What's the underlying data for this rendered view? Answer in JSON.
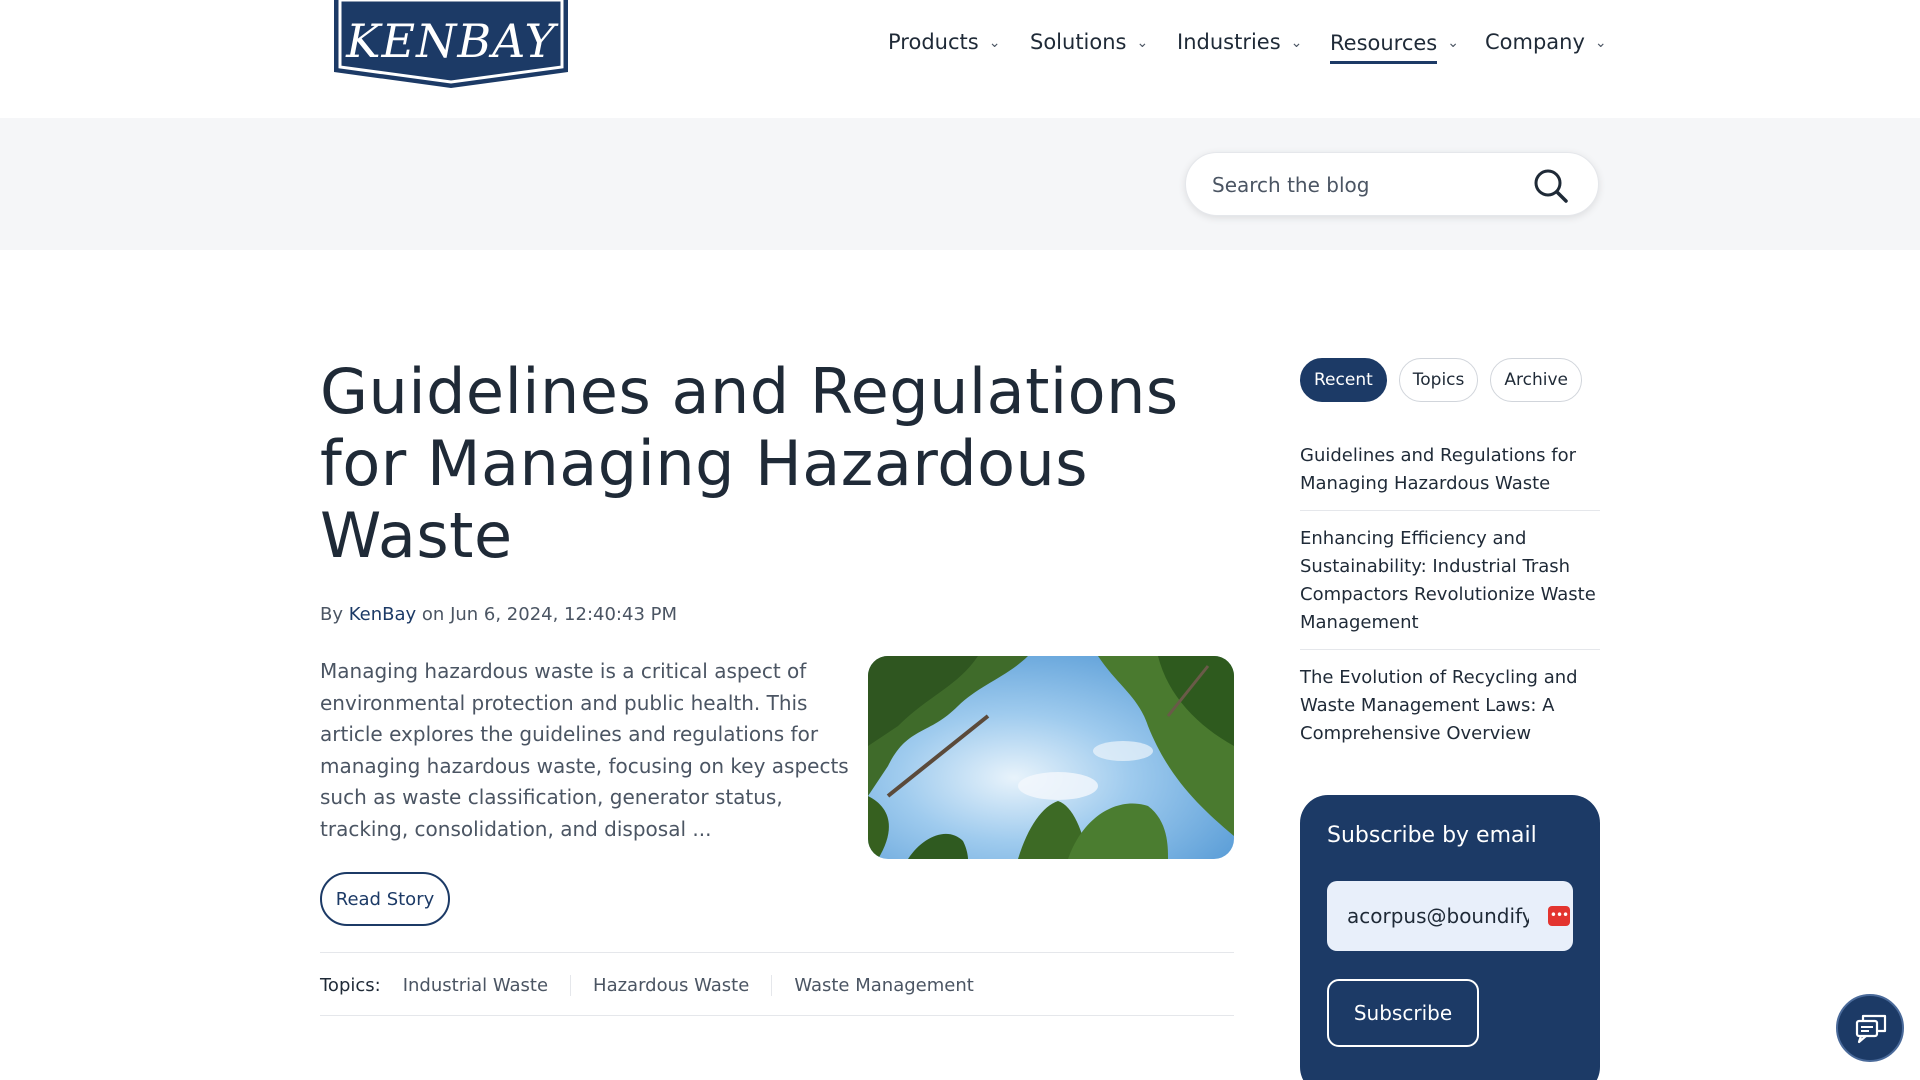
{
  "brand": {
    "logo_text": "KENBAY",
    "primary_color": "#1c3a66"
  },
  "nav": {
    "items": [
      {
        "label": "Products"
      },
      {
        "label": "Solutions"
      },
      {
        "label": "Industries"
      },
      {
        "label": "Resources",
        "active": true
      },
      {
        "label": "Company"
      }
    ],
    "chevron_icon": "chevron-down-icon"
  },
  "search": {
    "placeholder": "Search the blog",
    "icon": "search-icon"
  },
  "article": {
    "title": "Guidelines and Regulations for Managing Hazardous Waste",
    "by_label": "By",
    "author": "KenBay",
    "on_label": "on",
    "date": "Jun 6, 2024, 12:40:43 PM",
    "excerpt": "Managing hazardous waste is a critical aspect of environmental protection and public health. This article explores the guidelines and regulations for managing hazardous waste, focusing on key aspects such as waste classification, generator status, tracking, consolidation, and disposal ...",
    "read_label": "Read Story",
    "topics_label": "Topics:",
    "topics": [
      "Industrial Waste",
      "Hazardous Waste",
      "Waste Management"
    ]
  },
  "sidebar": {
    "tabs": [
      {
        "label": "Recent",
        "active": true
      },
      {
        "label": "Topics"
      },
      {
        "label": "Archive"
      }
    ],
    "recent": [
      "Guidelines and Regulations for Managing Hazardous Waste",
      "Enhancing Efficiency and Sustainability: Industrial Trash Compactors Revolutionize Waste Management",
      "The Evolution of Recycling and Waste Management Laws: A Comprehensive Overview"
    ],
    "subscribe": {
      "title": "Subscribe by email",
      "email_value": "acorpus@boundify",
      "button_label": "Subscribe"
    }
  },
  "chat": {
    "icon": "chat-icon"
  }
}
